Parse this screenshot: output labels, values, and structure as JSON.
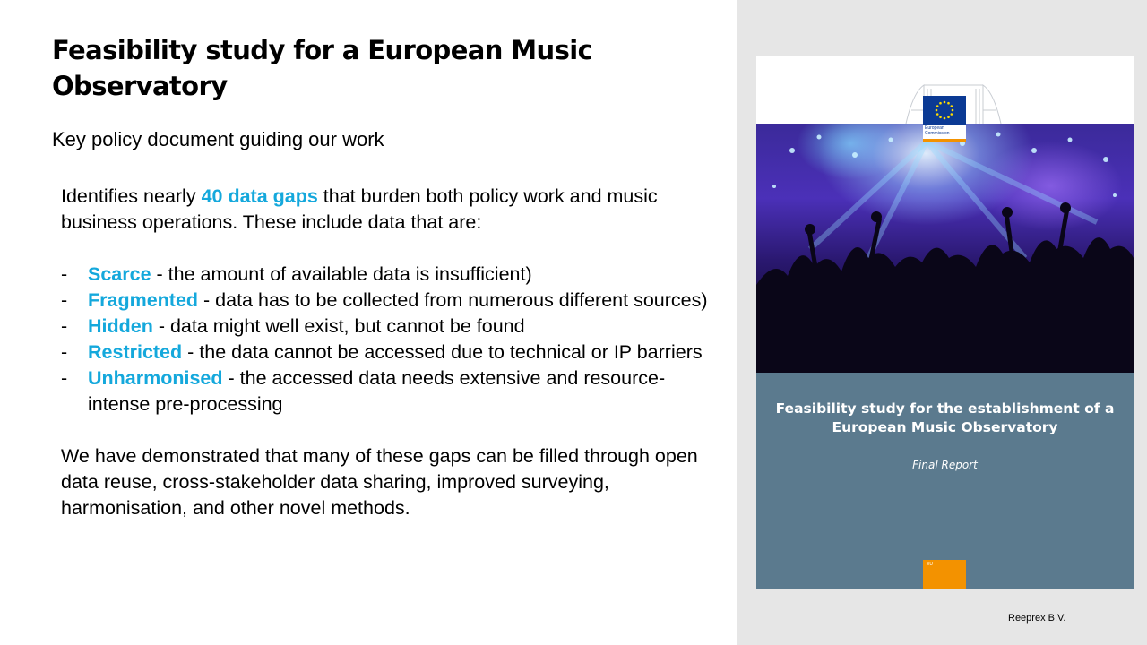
{
  "slide": {
    "title": "Feasibility study for a European Music Observatory",
    "subtitle": "Key policy document guiding our work",
    "intro": {
      "before": "Identifies nearly ",
      "highlight": "40 data gaps",
      "after": " that burden both policy work and music business operations. These include data that are:"
    },
    "items": [
      {
        "dash": "-",
        "term": "Scarce",
        "desc": " - the amount of available data is insufficient)"
      },
      {
        "dash": "-",
        "term": "Fragmented",
        "desc": " - data has to be collected from numerous different sources)"
      },
      {
        "dash": "-",
        "term": "Hidden",
        "desc": " - data might well exist, but cannot be found"
      },
      {
        "dash": "-",
        "term": "Restricted",
        "desc": " - the data cannot be accessed due to technical or IP barriers"
      },
      {
        "dash": "-",
        "term": "Unharmonised",
        "desc": " - the accessed data needs extensive and resource-intense pre-processing"
      }
    ],
    "conclusion": "We have demonstrated that many of these gaps can be filled through open data reuse, cross-stakeholder data sharing, improved surveying, harmonisation, and other novel methods."
  },
  "cover": {
    "logo_line1": "European",
    "logo_line2": "Commission",
    "title": "Feasibility study for the establishment of a European Music Observatory",
    "subtitle": "Final Report",
    "orange_label": "EU"
  },
  "footer": {
    "text": "Reeprex B.V."
  },
  "colors": {
    "accent": "#14a8dc",
    "cover_panel": "#5b7a8e",
    "eu_blue": "#0b3a94",
    "eu_orange": "#f39200",
    "side_panel": "#e6e6e6"
  }
}
